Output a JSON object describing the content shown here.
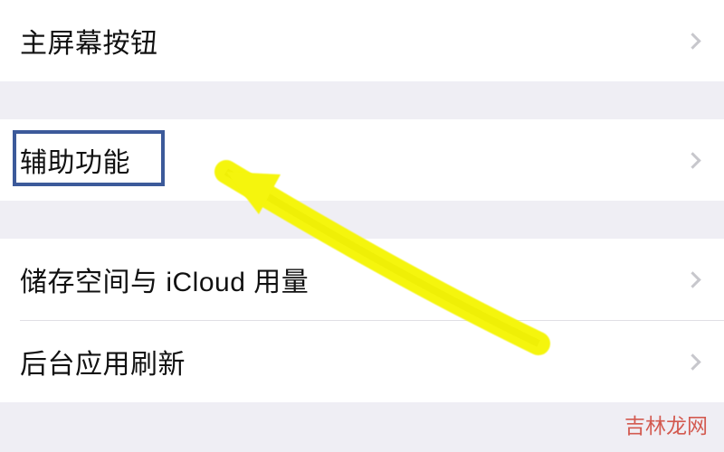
{
  "rows": {
    "home_button": "主屏幕按钮",
    "accessibility": "辅助功能",
    "storage_icloud": "储存空间与 iCloud 用量",
    "background_refresh": "后台应用刷新"
  },
  "watermark": "吉林龙网"
}
